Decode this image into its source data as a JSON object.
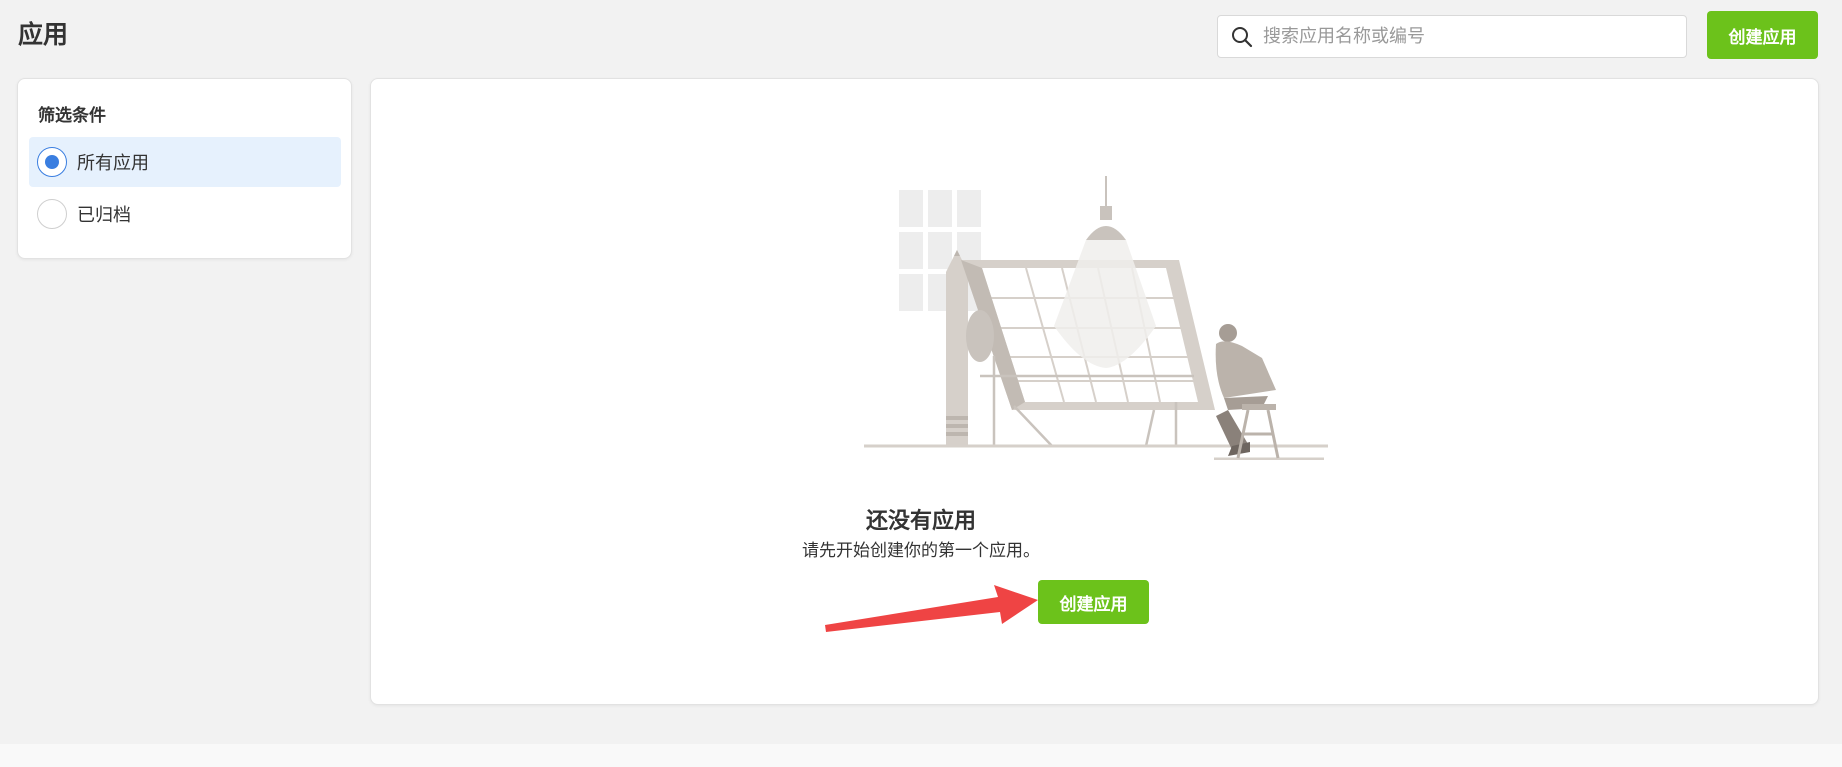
{
  "header": {
    "title": "应用",
    "search_placeholder": "搜索应用名称或编号",
    "search_value": "",
    "create_label": "创建应用"
  },
  "filter": {
    "title": "筛选条件",
    "options": [
      {
        "label": "所有应用",
        "selected": true
      },
      {
        "label": "已归档",
        "selected": false
      }
    ]
  },
  "empty_state": {
    "title": "还没有应用",
    "subtitle": "请先开始创建你的第一个应用。",
    "create_label": "创建应用"
  },
  "colors": {
    "accent_green": "#6cc21b",
    "selected_blue": "#3a7ee0",
    "selected_bg": "#e6f1fd",
    "annotation_arrow": "#ef4444"
  },
  "icons": {
    "search": "search-icon",
    "illustration": "empty-state-illustration",
    "annotation": "red-arrow-annotation"
  }
}
